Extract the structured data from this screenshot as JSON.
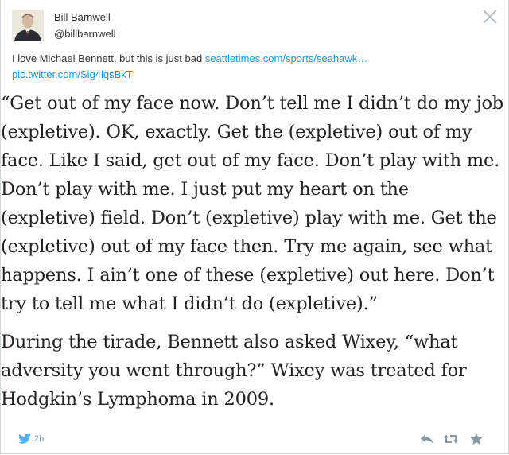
{
  "tweet": {
    "author_name": "Bill Barnwell",
    "author_handle": "@billbarnwell",
    "text_prefix": "I love Michael Bennett, but this is just bad ",
    "link_url": "seattletimes.com/sports/seahawk…",
    "pic_link": "pic.twitter.com/Sig4lqsBkT"
  },
  "article": {
    "paragraph1": "“Get out of my face now. Don’t tell me I didn’t do my job (expletive). OK, exactly. Get the (expletive) out of my face. Like I said, get out of my face. Don’t play with me. Don’t play with me. I just put my heart on the (expletive) field. Don’t (expletive) play with me. Get the (expletive) out of my face then. Try me again, see what happens. I ain’t one of these (expletive) out here. Don’t try to tell me what I didn’t do (expletive).”",
    "paragraph2": "During the tirade, Bennett also asked Wixey, “what adversity you went through?” Wixey was treated for Hodgkin’s Lymphoma in 2009."
  },
  "footer": {
    "time": "2h"
  },
  "icons": {
    "close": "close-icon",
    "bird": "twitter-bird-icon",
    "reply": "reply-icon",
    "retweet": "retweet-icon",
    "favorite": "star-icon"
  },
  "colors": {
    "link": "#1b95e0",
    "twitter_blue": "#55acee",
    "icon_gray": "#8899a6",
    "border": "#cfd9de"
  }
}
